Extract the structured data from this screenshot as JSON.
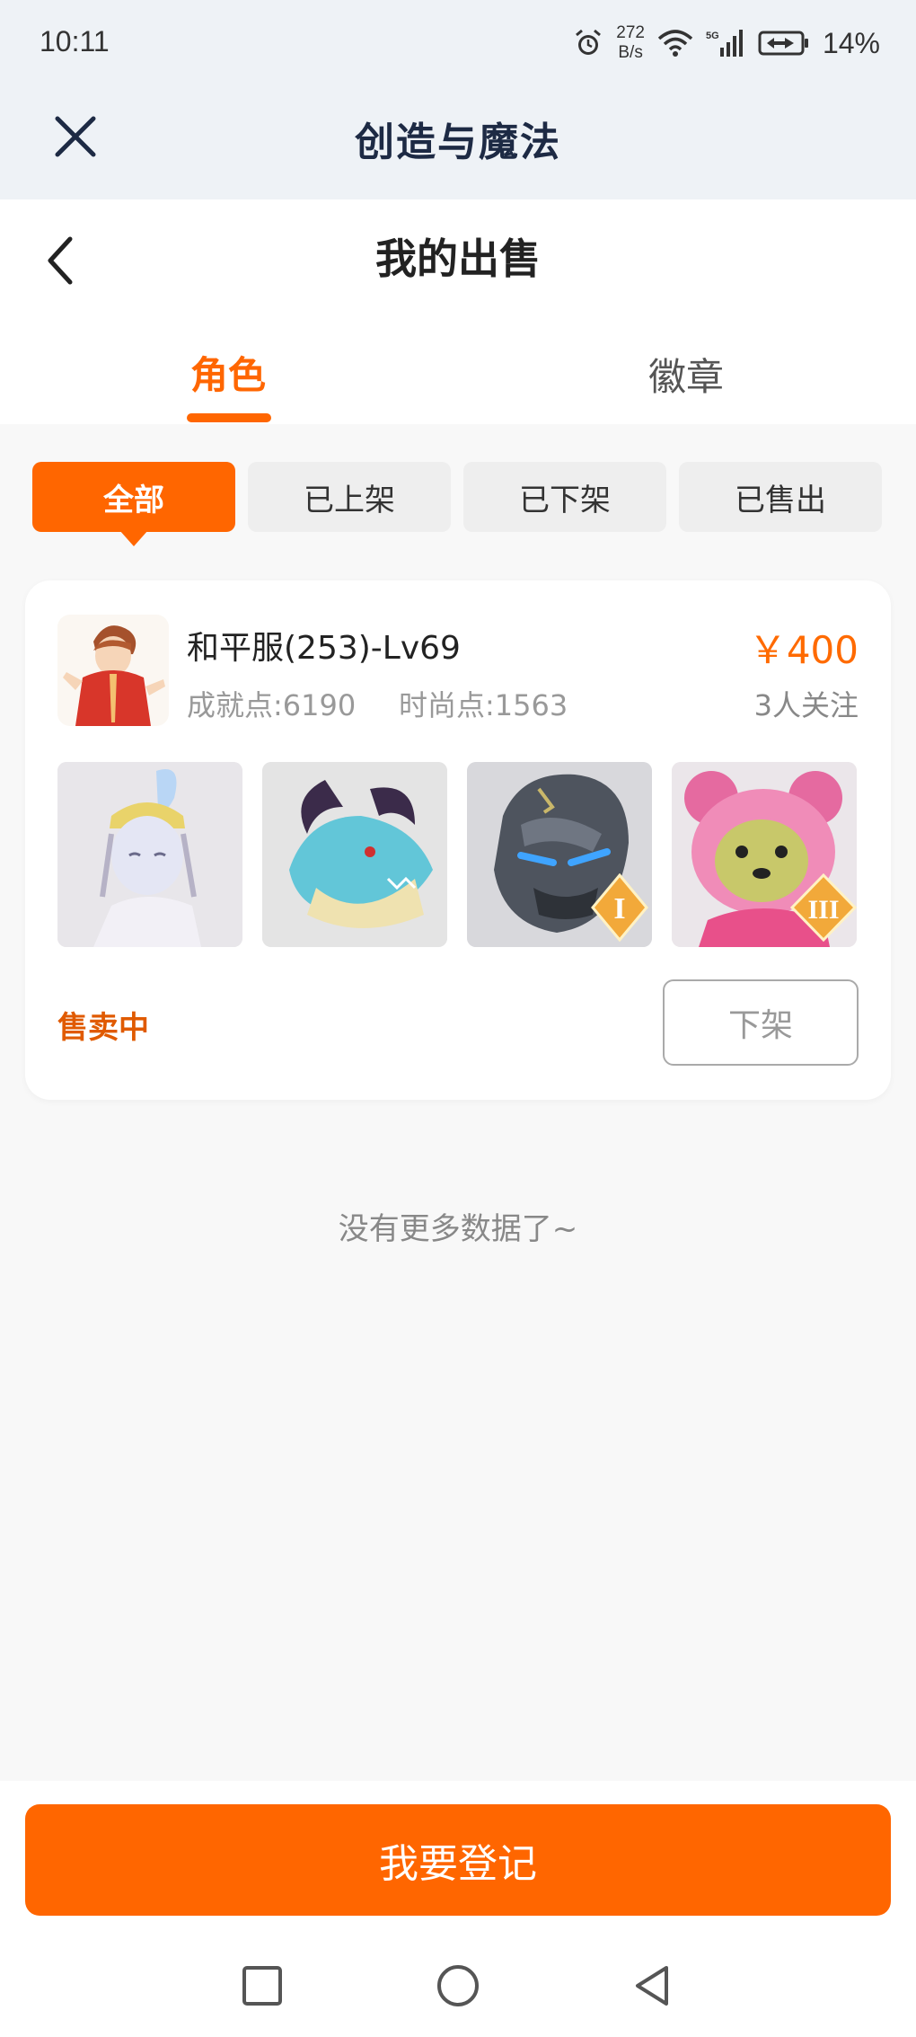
{
  "status_bar": {
    "time": "10:11",
    "net_speed_value": "272",
    "net_speed_unit": "B/s",
    "signal_label": "5G",
    "battery": "14%"
  },
  "app_bar": {
    "title": "创造与魔法"
  },
  "page": {
    "title": "我的出售",
    "tabs": [
      {
        "label": "角色",
        "active": true
      },
      {
        "label": "徽章",
        "active": false
      }
    ],
    "filters": [
      {
        "label": "全部",
        "active": true
      },
      {
        "label": "已上架",
        "active": false
      },
      {
        "label": "已下架",
        "active": false
      },
      {
        "label": "已售出",
        "active": false
      }
    ]
  },
  "listing": {
    "name": "和平服(253)-Lv69",
    "achievement": "成就点:6190",
    "fashion": "时尚点:1563",
    "price": "￥400",
    "followers": "3人关注",
    "status": "售卖中",
    "action": "下架",
    "thumbnails": [
      {
        "name": "fairy-costume",
        "badge": ""
      },
      {
        "name": "dragon-mount",
        "badge": ""
      },
      {
        "name": "stone-golem-mount",
        "badge": "I"
      },
      {
        "name": "pink-bear-pet",
        "badge": "III"
      }
    ]
  },
  "no_more_text": "没有更多数据了~",
  "bottom": {
    "register_label": "我要登记"
  },
  "colors": {
    "accent": "#ff6600",
    "price": "#ff6a00",
    "header_bg": "#eef2f6",
    "page_bg": "#f8f8f8"
  }
}
